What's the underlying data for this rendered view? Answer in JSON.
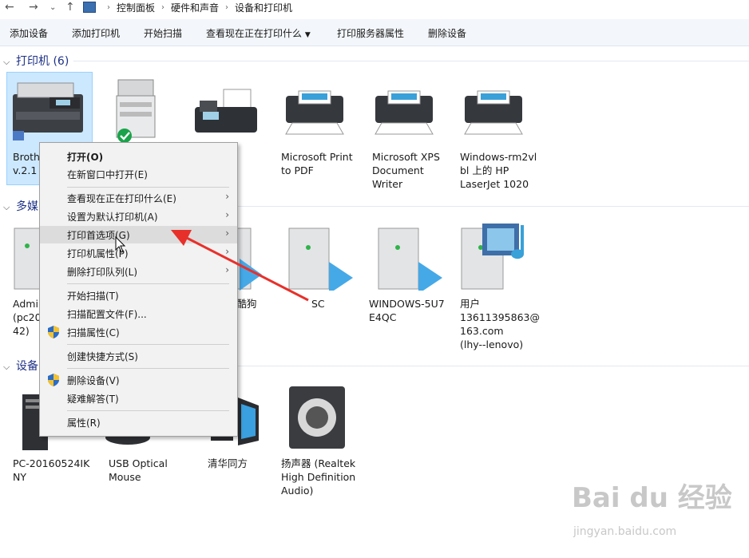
{
  "address": {
    "crumbs": [
      "控制面板",
      "硬件和声音",
      "设备和打印机"
    ]
  },
  "toolbar": {
    "add_device": "添加设备",
    "add_printer": "添加打印机",
    "start_scan": "开始扫描",
    "see_printing": "查看现在正在打印什么",
    "print_server_props": "打印服务器属性",
    "remove_device": "删除设备"
  },
  "groups": {
    "printers": "打印机 (6)",
    "multimedia": "多媒",
    "devices": "设备"
  },
  "printers": [
    {
      "label": "Broth\nv.2.1"
    },
    {
      "label": ""
    },
    {
      "label": ""
    },
    {
      "label": "Microsoft Print\nto PDF"
    },
    {
      "label": "Microsoft XPS\nDocument\nWriter"
    },
    {
      "label": "Windows-rm2vl\nbl 上的 HP\nLaserJet 1020"
    }
  ],
  "multimedia": [
    {
      "label": "Admi\n(pc20\n42)"
    },
    {
      "label": "的酷狗"
    },
    {
      "label": "SC"
    },
    {
      "label": "WINDOWS-5U7\nE4QC"
    },
    {
      "label": "用户\n13611395863@\n163.com\n(lhy--lenovo)"
    }
  ],
  "devices": [
    {
      "label": "PC-20160524IK\nNY"
    },
    {
      "label": "USB Optical\nMouse"
    },
    {
      "label": "清华同方"
    },
    {
      "label": "扬声器 (Realtek\nHigh Definition\nAudio)"
    }
  ],
  "context_menu": {
    "open": "打开(O)",
    "open_new_window": "在新窗口中打开(E)",
    "see_printing": "查看现在正在打印什么(E)",
    "set_default": "设置为默认打印机(A)",
    "print_prefs": "打印首选项(G)",
    "printer_props": "打印机属性(P)",
    "delete_queue": "删除打印队列(L)",
    "start_scan": "开始扫描(T)",
    "scan_profiles": "扫描配置文件(F)...",
    "scan_props": "扫描属性(C)",
    "create_shortcut": "创建快捷方式(S)",
    "remove_device": "删除设备(V)",
    "troubleshoot": "疑难解答(T)",
    "properties": "属性(R)"
  },
  "watermark": {
    "brand": "Bai du 经验",
    "url": "jingyan.baidu.com"
  },
  "colors": {
    "accent": "#1e3287",
    "selection": "#cce8ff",
    "arrow": "#e8302a"
  }
}
